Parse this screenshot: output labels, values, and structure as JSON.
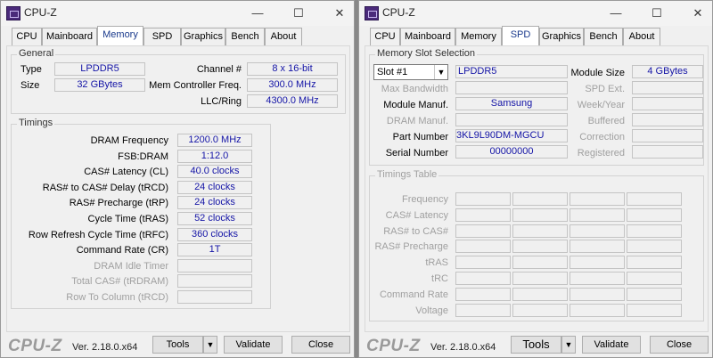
{
  "app_title": "CPU-Z",
  "window_buttons": {
    "min": "—",
    "max": "☐",
    "close": "✕"
  },
  "tabs": [
    "CPU",
    "Mainboard",
    "Memory",
    "SPD",
    "Graphics",
    "Bench",
    "About"
  ],
  "memory": {
    "general_label": "General",
    "type_label": "Type",
    "type_value": "LPDDR5",
    "size_label": "Size",
    "size_value": "32 GBytes",
    "channel_label": "Channel #",
    "channel_value": "8 x 16-bit",
    "mcf_label": "Mem Controller Freq.",
    "mcf_value": "300.0 MHz",
    "llc_label": "LLC/Ring",
    "llc_value": "4300.0 MHz",
    "timings_label": "Timings",
    "timings": [
      {
        "label": "DRAM Frequency",
        "value": "1200.0 MHz",
        "dim": false
      },
      {
        "label": "FSB:DRAM",
        "value": "1:12.0",
        "dim": false
      },
      {
        "label": "CAS# Latency (CL)",
        "value": "40.0 clocks",
        "dim": false
      },
      {
        "label": "RAS# to CAS# Delay (tRCD)",
        "value": "24 clocks",
        "dim": false
      },
      {
        "label": "RAS# Precharge (tRP)",
        "value": "24 clocks",
        "dim": false
      },
      {
        "label": "Cycle Time (tRAS)",
        "value": "52 clocks",
        "dim": false
      },
      {
        "label": "Row Refresh Cycle Time (tRFC)",
        "value": "360 clocks",
        "dim": false
      },
      {
        "label": "Command Rate (CR)",
        "value": "1T",
        "dim": false
      },
      {
        "label": "DRAM Idle Timer",
        "value": "",
        "dim": true
      },
      {
        "label": "Total CAS# (tRDRAM)",
        "value": "",
        "dim": true
      },
      {
        "label": "Row To Column (tRCD)",
        "value": "",
        "dim": true
      }
    ]
  },
  "spd": {
    "slot_group_label": "Memory Slot Selection",
    "slot_selected": "Slot #1",
    "slot_type": "LPDDR5",
    "module_size_label": "Module Size",
    "module_size_value": "4 GBytes",
    "max_bw_label": "Max Bandwidth",
    "spd_ext_label": "SPD Ext.",
    "module_manuf_label": "Module Manuf.",
    "module_manuf_value": "Samsung",
    "week_year_label": "Week/Year",
    "dram_manuf_label": "DRAM Manuf.",
    "buffered_label": "Buffered",
    "part_number_label": "Part Number",
    "part_number_value": "3KL9L90DM-MGCU",
    "correction_label": "Correction",
    "serial_label": "Serial Number",
    "serial_value": "00000000",
    "registered_label": "Registered",
    "timings_table_label": "Timings Table",
    "table_rows": [
      "Frequency",
      "CAS# Latency",
      "RAS# to CAS#",
      "RAS# Precharge",
      "tRAS",
      "tRC",
      "Command Rate",
      "Voltage"
    ]
  },
  "footer": {
    "logo": "CPU-Z",
    "version": "Ver. 2.18.0.x64",
    "tools_label": "Tools",
    "tools_arrow": "▼",
    "validate_label": "Validate",
    "close_label": "Close"
  }
}
